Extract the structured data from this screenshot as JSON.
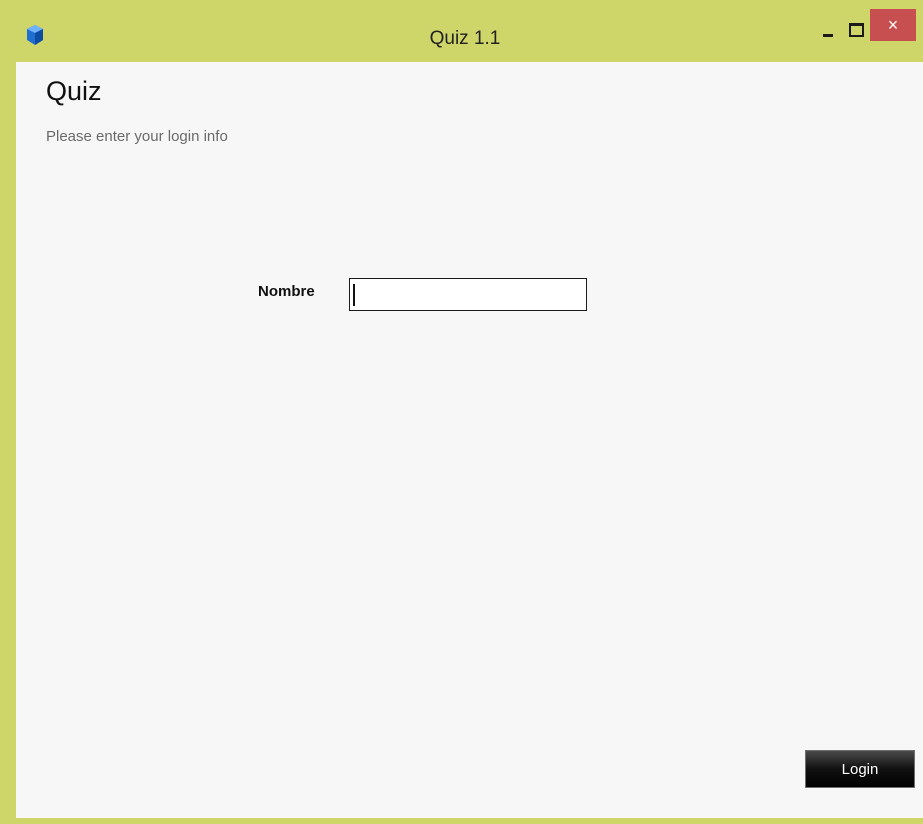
{
  "window": {
    "title": "Quiz 1.1",
    "app_icon": "cube-icon",
    "controls": {
      "minimize": "minimize-icon",
      "maximize": "maximize-icon",
      "close": "×"
    }
  },
  "page": {
    "title": "Quiz",
    "subtitle": "Please enter your login info"
  },
  "form": {
    "name_label": "Nombre",
    "name_value": "",
    "login_label": "Login"
  },
  "colors": {
    "window_frame": "#cfd669",
    "close_button": "#c74f4f",
    "client_background": "#f7f7f7",
    "login_button": "#000000"
  }
}
